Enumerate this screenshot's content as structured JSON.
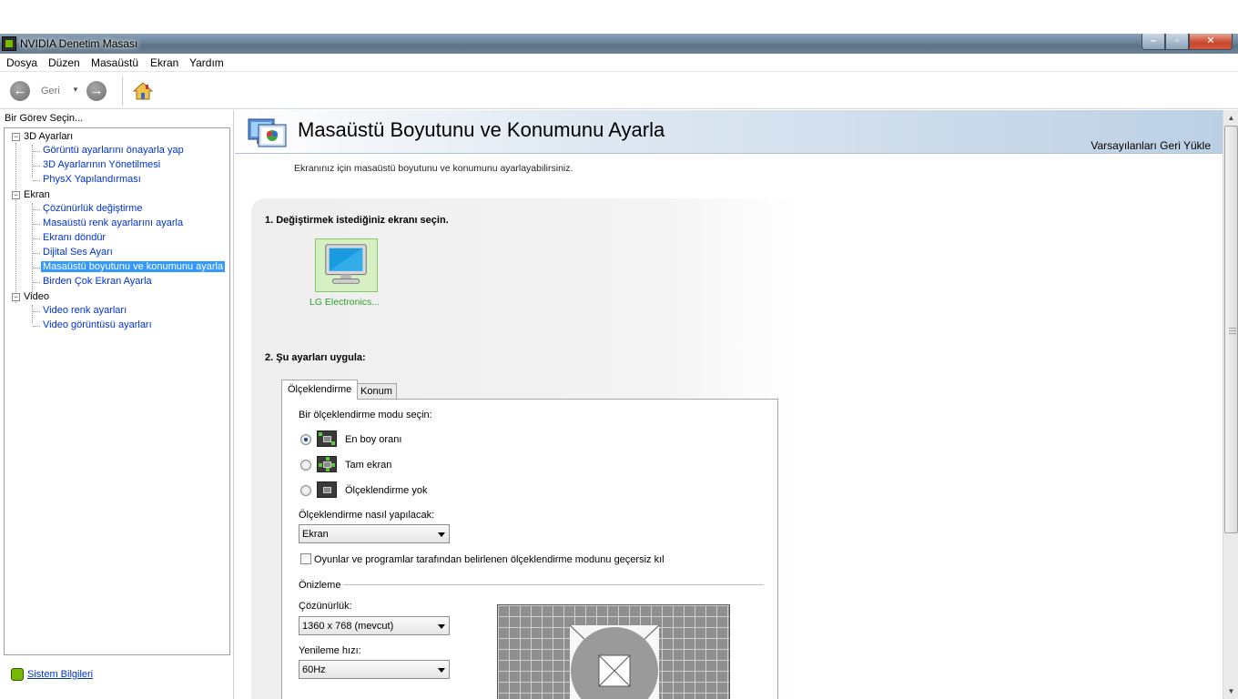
{
  "window": {
    "title": "NVIDIA Denetim Masası",
    "minimize": "–",
    "maximize": "▫",
    "close": "✕"
  },
  "menu": [
    "Dosya",
    "Düzen",
    "Masaüstü",
    "Ekran",
    "Yardım"
  ],
  "toolbar": {
    "back_label": "Geri",
    "icons": [
      "back-arrow-icon",
      "dropdown-arrow-icon",
      "forward-arrow-icon",
      "home-icon"
    ]
  },
  "sidebar": {
    "title": "Bir Görev Seçin...",
    "groups": [
      {
        "label": "3D Ayarları",
        "items": [
          "Görüntü ayarlarını önayarla yap",
          "3D Ayarlarının Yönetilmesi",
          "PhysX Yapılandırması"
        ]
      },
      {
        "label": "Ekran",
        "items": [
          "Çözünürlük değiştirme",
          "Masaüstü renk ayarlarını ayarla",
          "Ekranı döndür",
          "Dijital Ses Ayarı",
          "Masaüstü boyutunu ve konumunu ayarla",
          "Birden Çok Ekran Ayarla"
        ]
      },
      {
        "label": "Video",
        "items": [
          "Video renk ayarları",
          "Video görüntüsü ayarları"
        ]
      }
    ],
    "selected_item": "Masaüstü boyutunu ve konumunu ayarla",
    "system_info": "Sistem Bilgileri"
  },
  "main": {
    "title": "Masaüstü Boyutunu ve Konumunu Ayarla",
    "restore_defaults": "Varsayılanları Geri Yükle",
    "description": "Ekranınız için masaüstü boyutunu ve konumunu ayarlayabilirsiniz.",
    "step1": "1. Değiştirmek istediğiniz ekranı seçin.",
    "monitor_label": "LG Electronics...",
    "step2": "2. Şu ayarları uygula:",
    "tabs": [
      "Ölçeklendirme",
      "Konum"
    ],
    "scaling": {
      "mode_prompt": "Bir ölçeklendirme modu seçin:",
      "options": [
        "En boy oranı",
        "Tam ekran",
        "Ölçeklendirme yok"
      ],
      "selected": "En boy oranı",
      "how_label": "Ölçeklendirme nasıl yapılacak:",
      "how_value": "Ekran",
      "override_label": "Oyunlar ve programlar tarafından belirlenen ölçeklendirme modunu geçersiz kıl",
      "override_checked": false,
      "preview_label": "Önizleme",
      "resolution_label": "Çözünürlük:",
      "resolution_value": "1360 x 768 (mevcut)",
      "refresh_label": "Yenileme hızı:",
      "refresh_value": "60Hz"
    }
  },
  "colors": {
    "nvidia_green": "#76b900",
    "selection_blue": "#3399ff",
    "link_blue": "#0033cc",
    "monitor_label_green": "#29a329"
  }
}
